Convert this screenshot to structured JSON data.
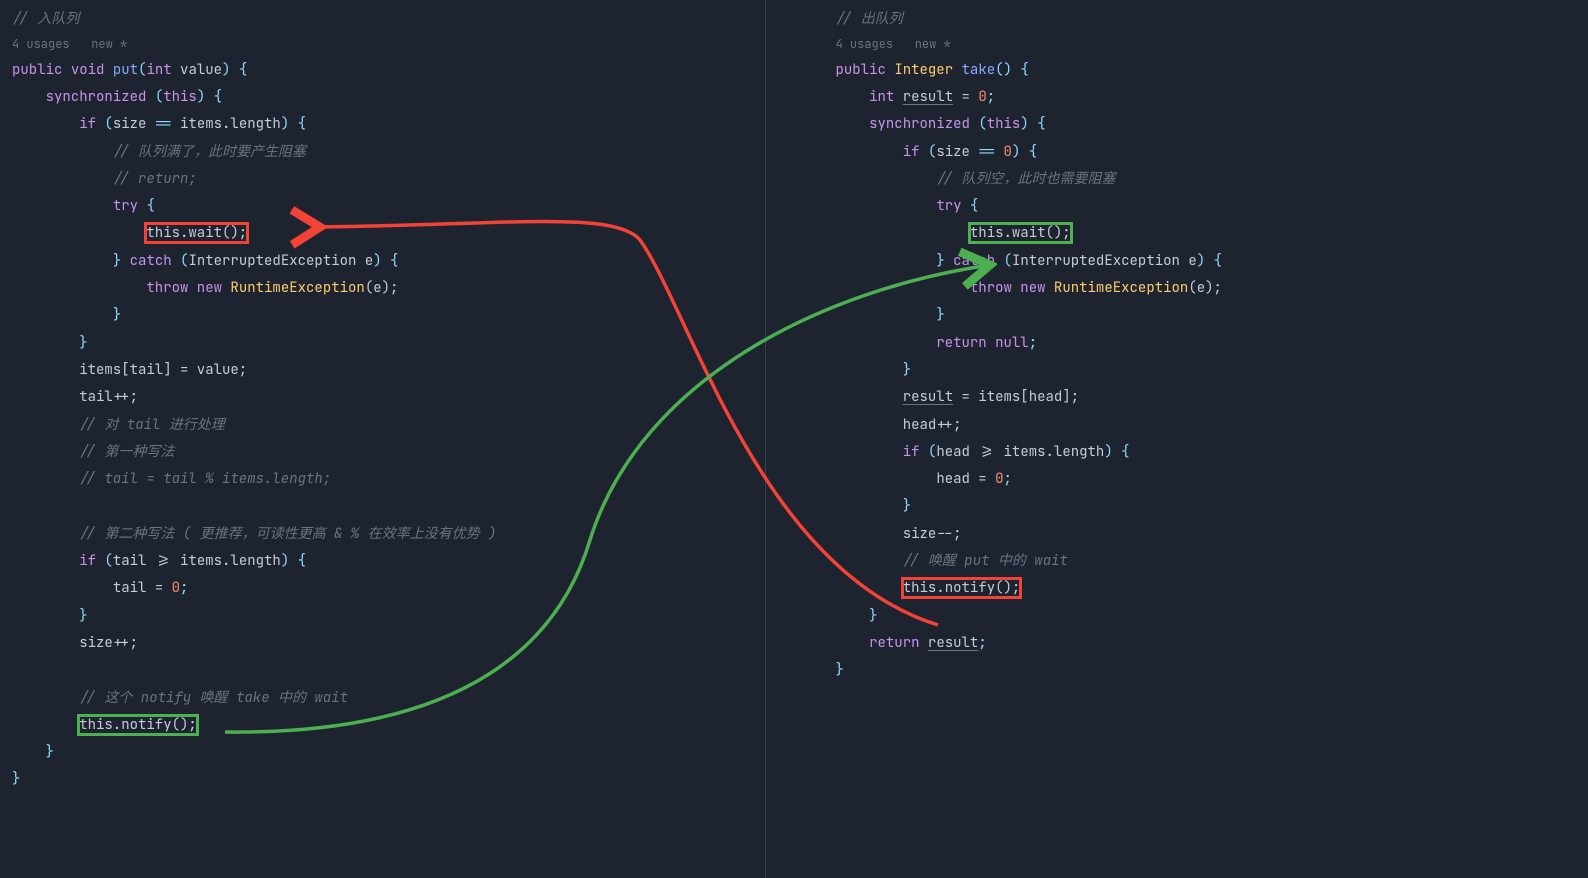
{
  "left": {
    "comment_title": "// 入队列",
    "meta": "4 usages   new *",
    "l1_public": "public",
    "l1_void": "void",
    "l1_method": "put",
    "l1_int": "int",
    "l1_value": "value",
    "l2_sync": "synchronized",
    "l2_this": "this",
    "l3_if": "if",
    "l3_expr_a": "size ",
    "l3_eq": "== ",
    "l3_expr_b": "items.length",
    "l4_c": "// 队列满了，此时要产生阻塞",
    "l5_c": "// return;",
    "l6_try": "try",
    "l7_wait": "this.wait();",
    "l8_catch": "catch",
    "l8_ex": "InterruptedException e",
    "l9_throw": "throw new",
    "l9_rt": "RuntimeException",
    "l9_e": "(e);",
    "l12_assign": "items[tail] = value;",
    "l13_inc": "tail++;",
    "l14_c": "// 对 tail 进行处理",
    "l15_c": "// 第一种写法",
    "l16_c": "// tail = tail % items.length;",
    "l18_c": "// 第二种写法 ( 更推荐，可读性更高 & % 在效率上没有优势 )",
    "l19_if": "if",
    "l19_expr": "tail >= items.length",
    "l20_assign": "tail = ",
    "l20_zero": "0",
    "l22_inc": "size++;",
    "l24_c": "// 这个 notify 唤醒 take 中的 wait",
    "l25_notify": "this.notify();"
  },
  "right": {
    "comment_title": "// 出队列",
    "meta": "4 usages   new *",
    "l1_public": "public",
    "l1_type": "Integer",
    "l1_method": "take",
    "l2_int": "int",
    "l2_var": "result",
    "l2_eq": " = ",
    "l2_zero": "0",
    "l3_sync": "synchronized",
    "l3_this": "this",
    "l4_if": "if",
    "l4_expr_a": "size ",
    "l4_eq": "== ",
    "l4_zero": "0",
    "l5_c": "// 队列空，此时也需要阻塞",
    "l6_try": "try",
    "l7_wait": "this.wait();",
    "l8_catch": "catch",
    "l8_ex": "InterruptedException e",
    "l9_throw": "throw new",
    "l9_rt": "RuntimeException",
    "l9_e": "(e);",
    "l11_ret": "return null",
    "l13_assign_a": "result",
    "l13_assign_b": " = items[head];",
    "l14_inc": "head++;",
    "l15_if": "if",
    "l15_expr": "head >= items.length",
    "l16_assign": "head = ",
    "l16_zero": "0",
    "l18_dec": "size--;",
    "l19_c": "// 唤醒 put 中的 wait",
    "l20_notify": "this.notify();",
    "l22_ret": "return",
    "l22_var": "result"
  }
}
